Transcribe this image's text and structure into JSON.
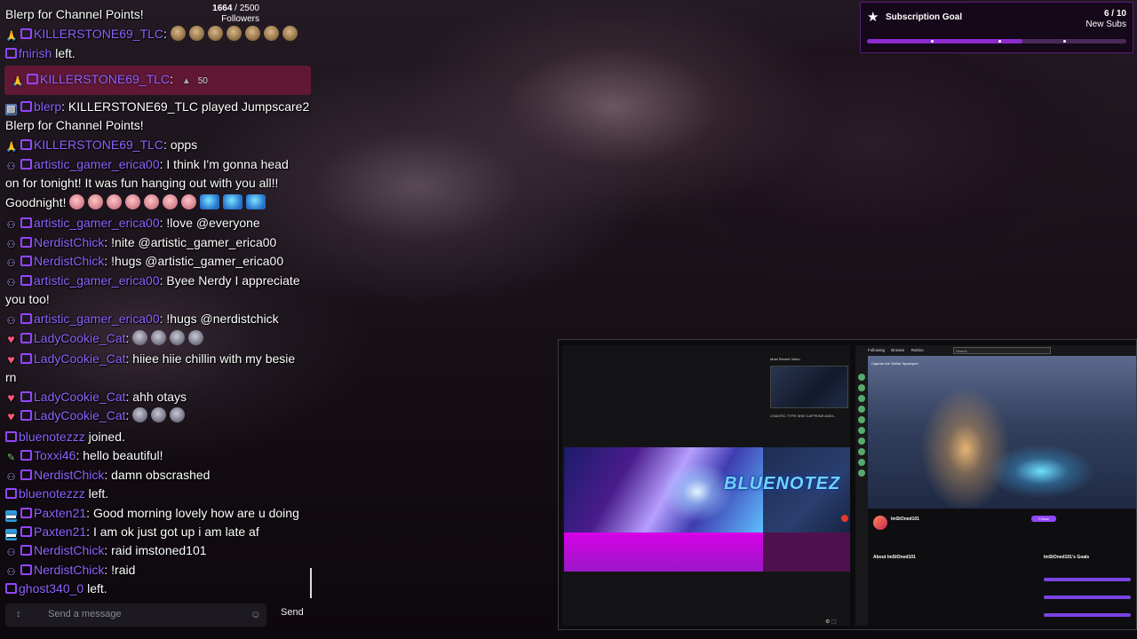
{
  "chat": {
    "followers": {
      "current": "1664",
      "target": "2500",
      "label": "Followers"
    },
    "highlight": {
      "user": "KILLERSTONE69_TLC",
      "amount": "50"
    },
    "messages": [
      {
        "user": "",
        "text": "Blerp for Channel Points!"
      },
      {
        "user": "KILLERSTONE69_TLC",
        "text": ""
      },
      {
        "user": "fnirish",
        "text": "left."
      },
      {
        "user": "blerp",
        "text": "KILLERSTONE69_TLC played Jumpscare2"
      },
      {
        "user": "",
        "text": "Blerp for Channel Points!"
      },
      {
        "user": "KILLERSTONE69_TLC",
        "text": "opps"
      },
      {
        "user": "artistic_gamer_erica00",
        "text": "I think I'm gonna head"
      },
      {
        "user": "",
        "text": "on for tonight! It was fun hanging out with you all!!"
      },
      {
        "user": "",
        "text": "Goodnight!"
      },
      {
        "user": "artistic_gamer_erica00",
        "text": "!love @everyone"
      },
      {
        "user": "NerdistChick",
        "text": "!nite @artistic_gamer_erica00"
      },
      {
        "user": "NerdistChick",
        "text": "!hugs @artistic_gamer_erica00"
      },
      {
        "user": "artistic_gamer_erica00",
        "text": "Byee Nerdy I appreciate"
      },
      {
        "user": "",
        "text": "you too!"
      },
      {
        "user": "artistic_gamer_erica00",
        "text": "!hugs @nerdistchick"
      },
      {
        "user": "LadyCookie_Cat",
        "text": ""
      },
      {
        "user": "LadyCookie_Cat",
        "text": "hiiee hiie chillin with my besie"
      },
      {
        "user": "",
        "text": "rn"
      },
      {
        "user": "LadyCookie_Cat",
        "text": "ahh otays"
      },
      {
        "user": "LadyCookie_Cat",
        "text": ""
      },
      {
        "user": "bluenotezzz",
        "text": "joined."
      },
      {
        "user": "Toxxi46",
        "text": "hello beautiful!"
      },
      {
        "user": "NerdistChick",
        "text": "damn obscrashed"
      },
      {
        "user": "bluenotezzz",
        "text": "left."
      },
      {
        "user": "Paxten21",
        "text": "Good morning lovely how are u doing"
      },
      {
        "user": "Paxten21",
        "text": "I am ok just got up i am late af"
      },
      {
        "user": "NerdistChick",
        "text": "raid imstoned101"
      },
      {
        "user": "NerdistChick",
        "text": "!raid"
      },
      {
        "user": "ghost340_0",
        "text": "left."
      }
    ],
    "input": {
      "placeholder": "Send a message",
      "send_label": "Send"
    }
  },
  "sub_goal": {
    "title": "Subscription Goal",
    "count": "6 / 10",
    "label": "New Subs",
    "progress": 0.6,
    "accent": "#8b2bd0"
  },
  "share": {
    "left": {
      "recent_label": "Most Recent Video",
      "recent_caption": "CHAOTIC TYPE SHIII CAFFEINE ADDI...",
      "banner_text": "BLUENOTEZ"
    },
    "right": {
      "nav": [
        "Following",
        "Browse",
        "Roblox"
      ],
      "search_placeholder": "Search",
      "stream_title": "Capture the Stellar Spaceport",
      "channel": "ImStOned101",
      "follow_label": "Follow",
      "about": "About ImStOned101",
      "goals": "ImStOned101's Goals"
    }
  }
}
